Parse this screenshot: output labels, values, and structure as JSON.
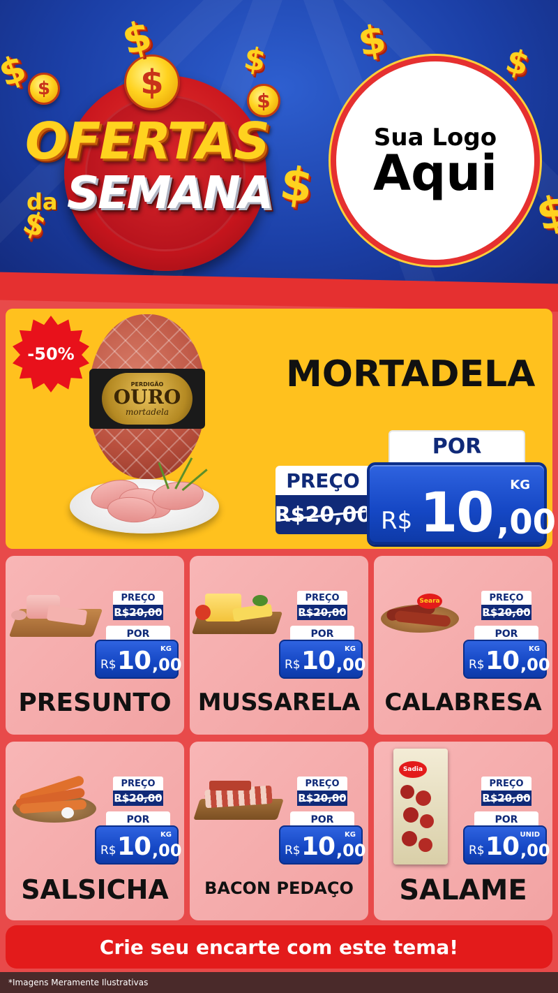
{
  "header": {
    "title_line1": "OFERTAS",
    "title_da": "da",
    "title_line2": "SEMANA",
    "logo_line1": "Sua Logo",
    "logo_line2": "Aqui",
    "coin_symbol": "$"
  },
  "featured": {
    "badge": "-50%",
    "name": "MORTADELA",
    "label_brand": "PERDIGÃO",
    "label_main": "OURO",
    "label_sub": "mortadela",
    "preco_label": "PREÇO",
    "old_price": "R$20,00",
    "por_label": "POR",
    "unit": "KG",
    "currency": "R$",
    "price_int": "10",
    "price_dec": ",00"
  },
  "products": [
    {
      "name": "PRESUNTO",
      "preco_label": "PREÇO",
      "old_price": "R$20,00",
      "por_label": "POR",
      "unit": "KG",
      "currency": "R$",
      "price_int": "10",
      "price_dec": ",00"
    },
    {
      "name": "MUSSARELA",
      "preco_label": "PREÇO",
      "old_price": "R$20,00",
      "por_label": "POR",
      "unit": "KG",
      "currency": "R$",
      "price_int": "10",
      "price_dec": ",00"
    },
    {
      "name": "CALABRESA",
      "preco_label": "PREÇO",
      "old_price": "R$20,00",
      "por_label": "POR",
      "unit": "KG",
      "currency": "R$",
      "price_int": "10",
      "price_dec": ",00",
      "brand": "Seara"
    },
    {
      "name": "SALSICHA",
      "preco_label": "PREÇO",
      "old_price": "R$20,00",
      "por_label": "POR",
      "unit": "KG",
      "currency": "R$",
      "price_int": "10",
      "price_dec": ",00"
    },
    {
      "name": "BACON PEDAÇO",
      "preco_label": "PREÇO",
      "old_price": "R$20,00",
      "por_label": "POR",
      "unit": "KG",
      "currency": "R$",
      "price_int": "10",
      "price_dec": ",00"
    },
    {
      "name": "SALAME",
      "preco_label": "PREÇO",
      "old_price": "R$20,00",
      "por_label": "POR",
      "unit": "UNID",
      "currency": "R$",
      "price_int": "10",
      "price_dec": ",00",
      "brand": "Sadia"
    }
  ],
  "footer": {
    "cta": "Crie seu encarte com este tema!",
    "disclaimer": "*Imagens Meramente Ilustrativas"
  },
  "colors": {
    "header_blue": "#1b3fa6",
    "accent_red": "#e31b1b",
    "featured_yellow": "#ffc11e",
    "price_blue": "#1547c4",
    "navy": "#102a78",
    "card_pink": "#f8b6b6"
  }
}
